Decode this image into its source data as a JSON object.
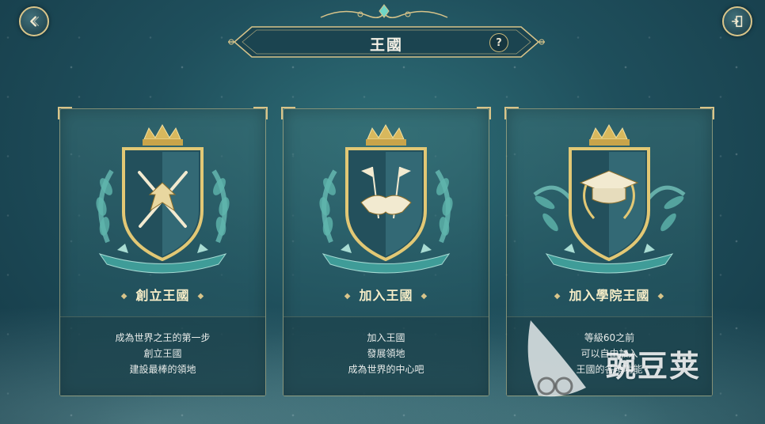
{
  "header": {
    "title": "王國",
    "help_label": "?"
  },
  "cards": [
    {
      "title": "創立王國",
      "desc": [
        "成為世界之王的第一步",
        "創立王國",
        "建設最棒的領地"
      ]
    },
    {
      "title": "加入王國",
      "desc": [
        "加入王國",
        "發展領地",
        "成為世界的中心吧"
      ]
    },
    {
      "title": "加入學院王國",
      "desc": [
        "等級60之前",
        "可以自由加入",
        "王國的各項功能"
      ]
    }
  ],
  "icons": {
    "back": "back-arrow-icon",
    "exit": "exit-door-icon",
    "card_1": "crossed-swords-eagle-shield-icon",
    "card_2": "handshake-flags-shield-icon",
    "card_3": "graduation-cap-laurel-shield-icon"
  },
  "colors": {
    "gold": "#d8c48a",
    "background": "#1f4f5c",
    "card_title": "#f7eec8"
  },
  "watermark": {
    "text": "豌豆荚"
  }
}
